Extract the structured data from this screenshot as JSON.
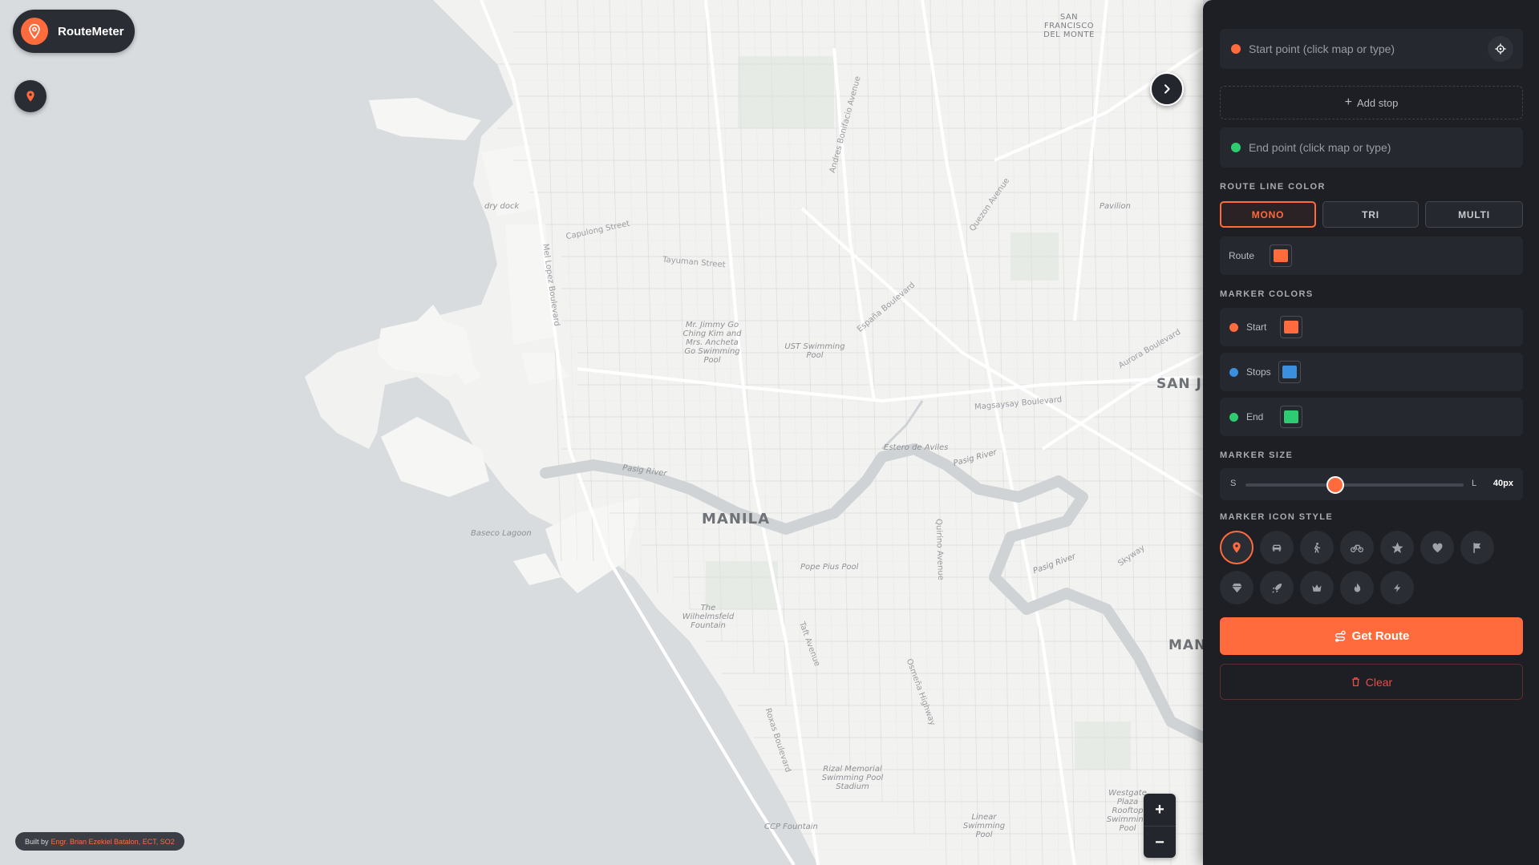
{
  "app": {
    "name": "RouteMeter"
  },
  "map": {
    "labels": {
      "city": "MANILA",
      "district1": "SAN FRANCISCO DEL MONTE",
      "district2": "SAN J",
      "district3": "MAN",
      "dry_dock": "dry dock",
      "baseco": "Baseco Lagoon",
      "pavilion": "Pavilion",
      "estero": "Estero de Aviles",
      "pasig1": "Pasig River",
      "pasig2": "Pasig River",
      "pasig3": "Pasig River",
      "pope": "Pope Pius Pool",
      "wilhelmsfeld": "The Wilhelmsfeld Fountain",
      "ust": "UST Swimming Pool",
      "mrjimmy": "Mr. Jimmy Go Ching Kim and Mrs. Ancheta Go Swimming Pool",
      "rizal_pool": "Rizal Memorial Swimming Pool Stadium",
      "ccp": "CCP Fountain",
      "linear": "Linear Swimming Pool",
      "westgate": "Westgate Plaza Rooftop Swimming Pool",
      "capulong": "Capulong Street",
      "tayuman": "Tayuman Street",
      "mel_lopez": "Mel Lopez Boulevard",
      "magsaysay": "Magsaysay Boulevard",
      "andres": "Andres Bonifacio Avenue",
      "quezon": "Quezon Avenue",
      "espana": "España Boulevard",
      "skyway": "Skyway",
      "aurora": "Aurora Boulevard",
      "roxas": "Roxas Boulevard",
      "taft": "Taft Avenue",
      "osmena": "Osmeña Highway",
      "quirino": "Quirino Avenue"
    },
    "zoom_in": "+",
    "zoom_out": "−"
  },
  "credit": {
    "prefix": "Built by",
    "author": "Engr. Brian Ezekiel Batalon, ECT, SO2"
  },
  "panel": {
    "start_placeholder": "Start point (click map or type)",
    "add_stop": "Add stop",
    "end_placeholder": "End point (click map or type)",
    "route_color_title": "ROUTE LINE COLOR",
    "modes": [
      "MONO",
      "TRI",
      "MULTI"
    ],
    "active_mode": "MONO",
    "route_label": "Route",
    "marker_colors_title": "MARKER COLORS",
    "marker_rows": [
      {
        "label": "Start",
        "color": "#ff6b3d"
      },
      {
        "label": "Stops",
        "color": "#3b8fe0"
      },
      {
        "label": "End",
        "color": "#2ecc71"
      }
    ],
    "route_color": "#ff6b3d",
    "marker_size_title": "MARKER SIZE",
    "size_min": "S",
    "size_max": "L",
    "size_value": "40px",
    "size_fraction": 0.41,
    "icon_style_title": "MARKER ICON STYLE",
    "icons": [
      "pin-icon",
      "car-icon",
      "walk-icon",
      "bike-icon",
      "star-icon",
      "heart-icon",
      "flag-icon",
      "diamond-icon",
      "rocket-icon",
      "crown-icon",
      "fire-icon",
      "bolt-icon"
    ],
    "active_icon": "pin-icon",
    "get_route": "Get Route",
    "clear": "Clear"
  },
  "colors": {
    "accent": "#ff6b3d",
    "panel_bg": "#1d1f24",
    "danger": "#ef4a4a"
  }
}
